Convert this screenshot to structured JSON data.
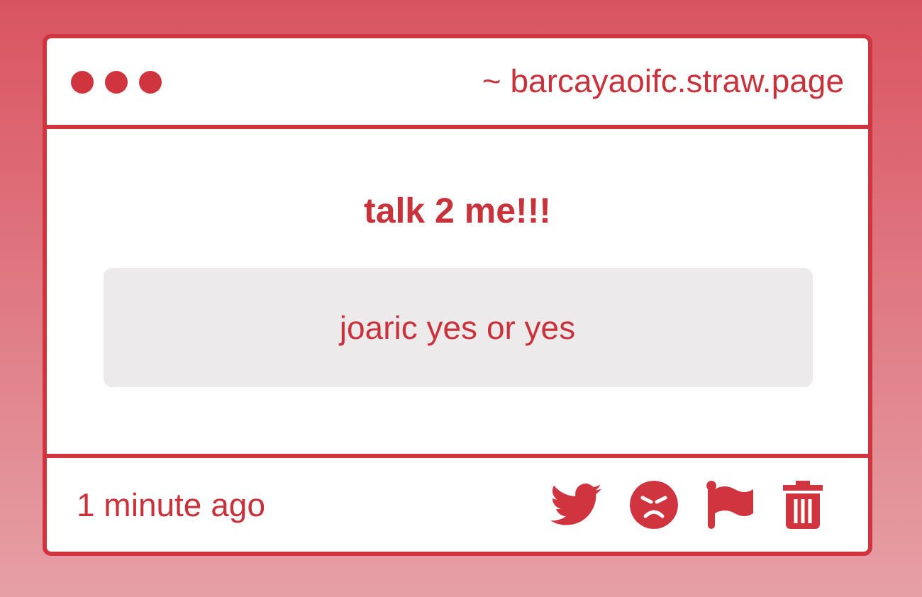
{
  "window": {
    "url": "~ barcayaoifc.straw.page"
  },
  "question": "talk 2 me!!!",
  "answer": "joaric yes or yes",
  "footer": {
    "time": "1 minute ago"
  }
}
